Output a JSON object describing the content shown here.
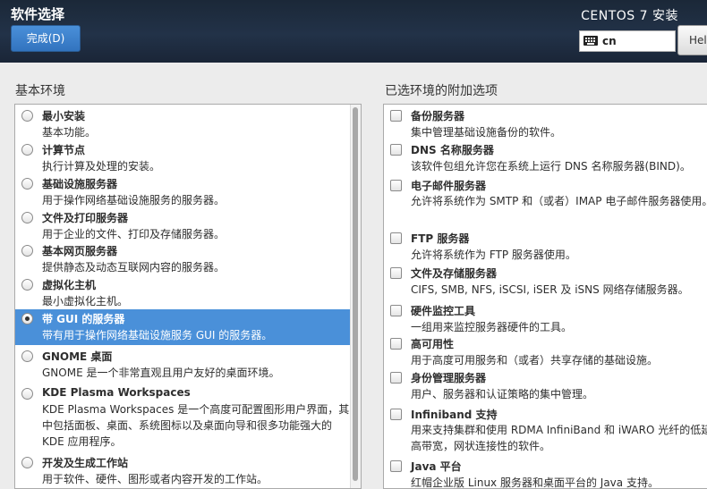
{
  "header": {
    "title": "软件选择",
    "done_button": "完成(D)",
    "product": "CENTOS 7 安装",
    "keyboard_layout": "cn",
    "help_button": "Help!"
  },
  "left": {
    "label": "基本环境",
    "items": [
      {
        "title": "最小安装",
        "desc": "基本功能。"
      },
      {
        "title": "计算节点",
        "desc": "执行计算及处理的安装。"
      },
      {
        "title": "基础设施服务器",
        "desc": "用于操作网络基础设施服务的服务器。"
      },
      {
        "title": "文件及打印服务器",
        "desc": "用于企业的文件、打印及存储服务器。"
      },
      {
        "title": "基本网页服务器",
        "desc": "提供静态及动态互联网内容的服务器。"
      },
      {
        "title": "虚拟化主机",
        "desc": "最小虚拟化主机。"
      },
      {
        "title": "带 GUI 的服务器",
        "desc": "带有用于操作网络基础设施服务 GUI 的服务器。",
        "selected": true
      },
      {
        "title": "GNOME 桌面",
        "desc": "GNOME 是一个非常直观且用户友好的桌面环境。"
      },
      {
        "title": "KDE Plasma Workspaces",
        "desc": "KDE Plasma Workspaces 是一个高度可配置图形用户界面，其中包括面板、桌面、系统图标以及桌面向导和很多功能强大的 KDE 应用程序。"
      },
      {
        "title": "开发及生成工作站",
        "desc": "用于软件、硬件、图形或者内容开发的工作站。"
      }
    ]
  },
  "right": {
    "label": "已选环境的附加选项",
    "items": [
      {
        "title": "备份服务器",
        "desc": "集中管理基础设施备份的软件。"
      },
      {
        "title": "DNS 名称服务器",
        "desc": "该软件包组允许您在系统上运行 DNS 名称服务器(BIND)。"
      },
      {
        "title": "电子邮件服务器",
        "desc": "允许将系统作为 SMTP 和（或者）IMAP 电子邮件服务器使用。"
      },
      {
        "title": "FTP 服务器",
        "desc": "允许将系统作为 FTP 服务器使用。"
      },
      {
        "title": "文件及存储服务器",
        "desc": "CIFS, SMB, NFS, iSCSI, iSER 及 iSNS 网络存储服务器。"
      },
      {
        "title": "硬件监控工具",
        "desc": "一组用来监控服务器硬件的工具。"
      },
      {
        "title": "高可用性",
        "desc": "用于高度可用服务和（或者）共享存储的基础设施。"
      },
      {
        "title": "身份管理服务器",
        "desc": "用户、服务器和认证策略的集中管理。"
      },
      {
        "title": "Infiniband 支持",
        "desc": "用来支持集群和使用 RDMA InfiniBand 和 iWARO 光纤的低延迟，高带宽，网状连接性的软件。"
      },
      {
        "title": "Java 平台",
        "desc": "红帽企业版 Linux 服务器和桌面平台的 Java 支持。"
      }
    ]
  },
  "colors": {
    "header_bg": "#1f2d40",
    "selection": "#4a90d9",
    "done_button": "#3a80cc"
  }
}
